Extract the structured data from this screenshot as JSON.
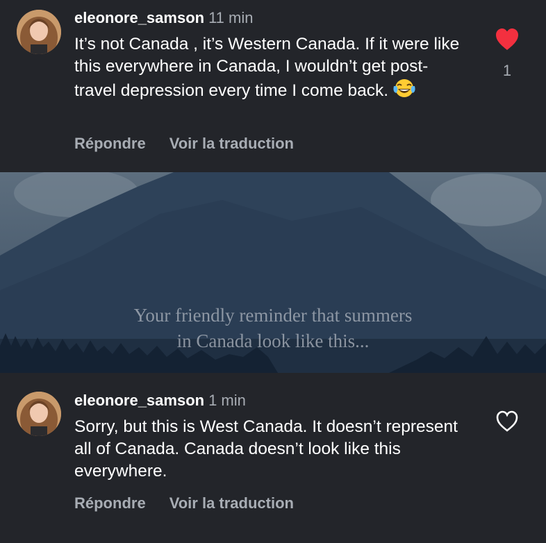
{
  "comments": [
    {
      "username": "eleonore_samson",
      "time": "11 min",
      "text": "It’s not Canada , it’s Western Canada. If it were like this everywhere in Canada, I wouldn’t get post-travel depression every time I come back.",
      "emoji": "face-with-tears-of-joy",
      "actions": {
        "reply": "Répondre",
        "translate": "Voir la traduction"
      },
      "liked": true,
      "like_count": "1"
    },
    {
      "username": "eleonore_samson",
      "time": "1 min",
      "text": "Sorry, but this is West Canada. It doesn’t represent all of Canada. Canada doesn’t look like this everywhere.",
      "actions": {
        "reply": "Répondre",
        "translate": "Voir la traduction"
      },
      "liked": false
    }
  ],
  "media": {
    "caption_line1": "Your friendly reminder that summers",
    "caption_line2": "in Canada look like this..."
  },
  "colors": {
    "background": "#23252a",
    "secondary_text": "#a8adb4",
    "like_red": "#f3303f"
  }
}
